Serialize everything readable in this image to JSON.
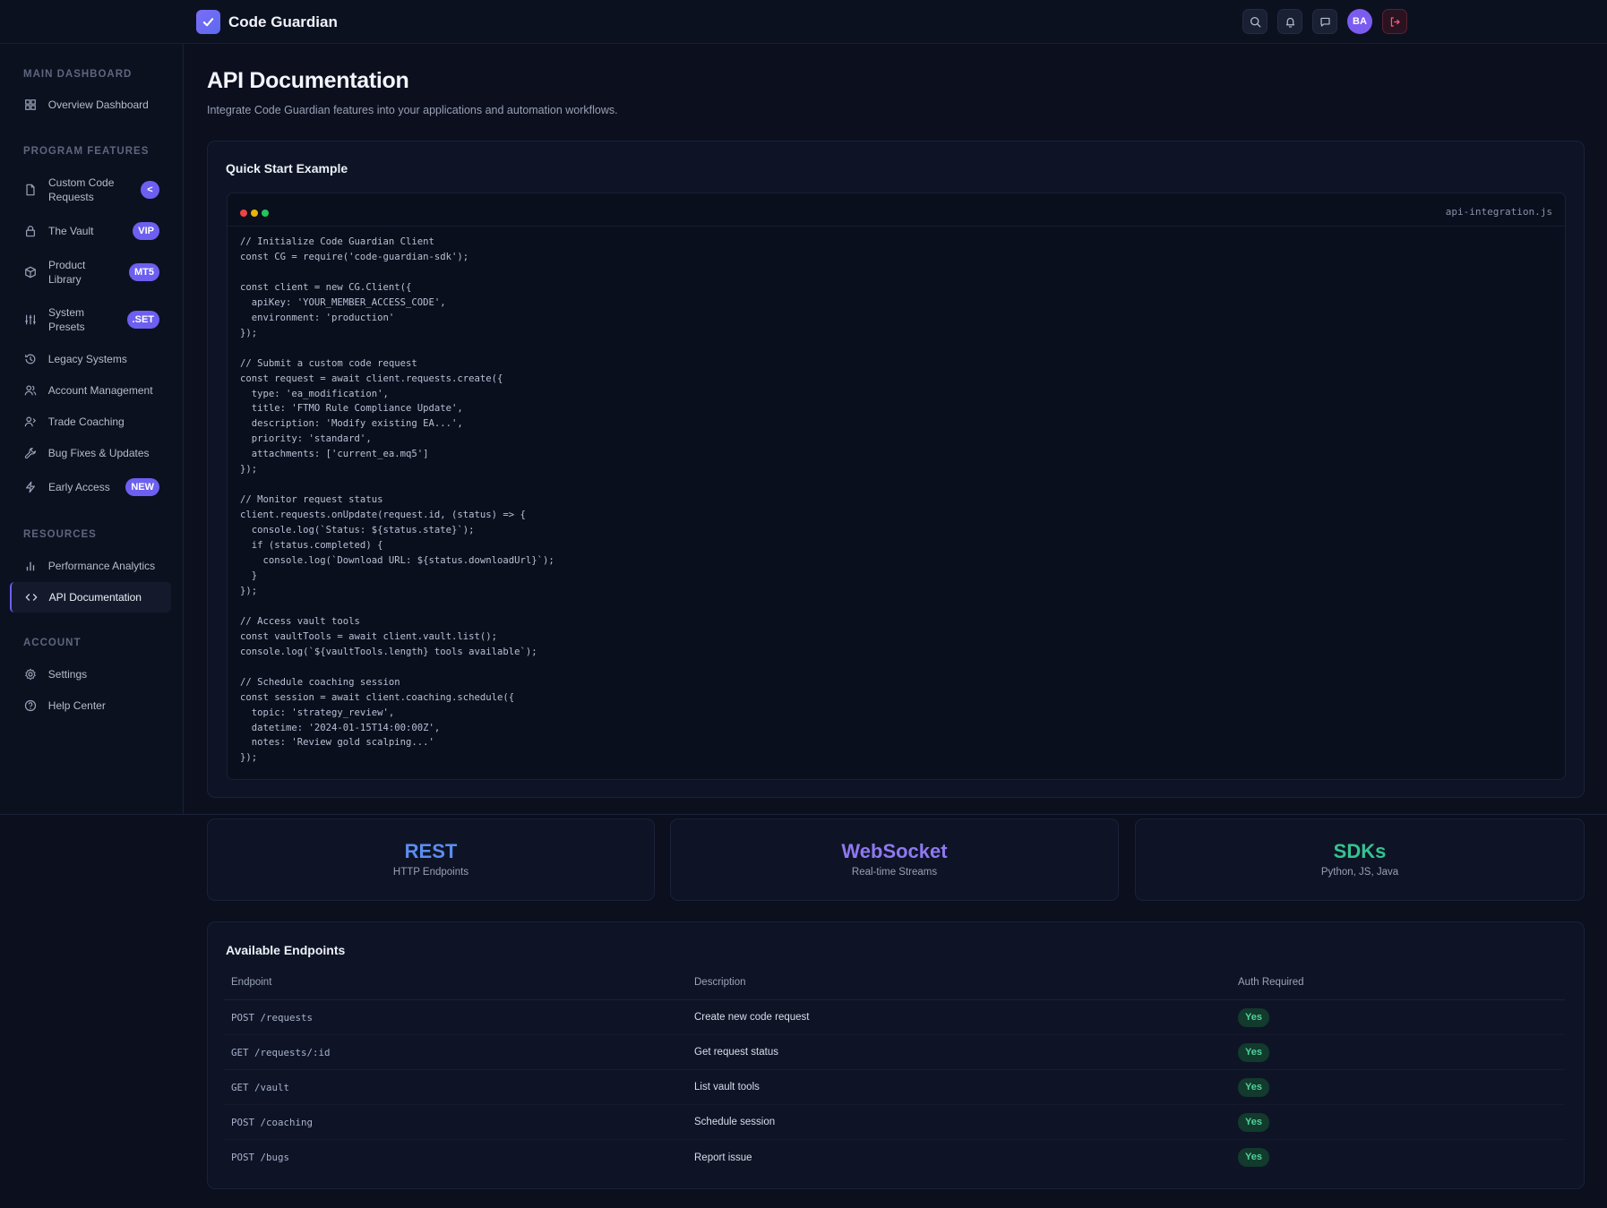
{
  "app": {
    "name": "Code Guardian",
    "user_initials": "BA"
  },
  "colors": {
    "accent": "#6d5ff0",
    "rest": "#5b8df0",
    "websocket": "#8f78f0",
    "sdks": "#34c38f",
    "success": "#4fd39a"
  },
  "topbar": {
    "icons": [
      "search-icon",
      "bell-icon",
      "message-icon",
      "logout-icon"
    ]
  },
  "sidebar": {
    "sections": {
      "main": "MAIN DASHBOARD",
      "features": "PROGRAM FEATURES",
      "resources": "RESOURCES",
      "account": "ACCOUNT"
    },
    "items": [
      {
        "label": "Overview Dashboard",
        "icon": "grid-icon"
      },
      {
        "label": "Custom Code Requests",
        "icon": "file-icon",
        "badge": "<"
      },
      {
        "label": "The Vault",
        "icon": "lock-icon",
        "badge": "VIP"
      },
      {
        "label": "Product Library",
        "icon": "box-icon",
        "badge": "MT5"
      },
      {
        "label": "System Presets",
        "icon": "sliders-icon",
        "badge": ".SET"
      },
      {
        "label": "Legacy Systems",
        "icon": "history-icon"
      },
      {
        "label": "Account Management",
        "icon": "users-icon"
      },
      {
        "label": "Trade Coaching",
        "icon": "coaching-icon"
      },
      {
        "label": "Bug Fixes & Updates",
        "icon": "wrench-icon"
      },
      {
        "label": "Early Access",
        "icon": "bolt-icon",
        "badge": "NEW"
      },
      {
        "label": "Performance Analytics",
        "icon": "bar-chart-icon"
      },
      {
        "label": "API Documentation",
        "icon": "code-icon",
        "active": true
      },
      {
        "label": "Settings",
        "icon": "gear-icon"
      },
      {
        "label": "Help Center",
        "icon": "help-icon"
      }
    ]
  },
  "main": {
    "title": "API Documentation",
    "subtitle": "Integrate Code Guardian features into your applications and automation workflows.",
    "quick_start": {
      "title": "Quick Start Example",
      "filename": "api-integration.js",
      "code": "// Initialize Code Guardian Client\nconst CG = require('code-guardian-sdk');\n\nconst client = new CG.Client({\n  apiKey: 'YOUR_MEMBER_ACCESS_CODE',\n  environment: 'production'\n});\n\n// Submit a custom code request\nconst request = await client.requests.create({\n  type: 'ea_modification',\n  title: 'FTMO Rule Compliance Update',\n  description: 'Modify existing EA...',\n  priority: 'standard',\n  attachments: ['current_ea.mq5']\n});\n\n// Monitor request status\nclient.requests.onUpdate(request.id, (status) => {\n  console.log(`Status: ${status.state}`);\n  if (status.completed) {\n    console.log(`Download URL: ${status.downloadUrl}`);\n  }\n});\n\n// Access vault tools\nconst vaultTools = await client.vault.list();\nconsole.log(`${vaultTools.length} tools available`);\n\n// Schedule coaching session\nconst session = await client.coaching.schedule({\n  topic: 'strategy_review',\n  datetime: '2024-01-15T14:00:00Z',\n  notes: 'Review gold scalping...'\n});"
    },
    "protocols": [
      {
        "title": "REST",
        "subtitle": "HTTP Endpoints"
      },
      {
        "title": "WebSocket",
        "subtitle": "Real-time Streams"
      },
      {
        "title": "SDKs",
        "subtitle": "Python, JS, Java"
      }
    ],
    "endpoints": {
      "title": "Available Endpoints",
      "columns": [
        "Endpoint",
        "Description",
        "Auth Required"
      ],
      "rows": [
        {
          "endpoint": "POST /requests",
          "description": "Create new code request",
          "auth": "Yes"
        },
        {
          "endpoint": "GET /requests/:id",
          "description": "Get request status",
          "auth": "Yes"
        },
        {
          "endpoint": "GET /vault",
          "description": "List vault tools",
          "auth": "Yes"
        },
        {
          "endpoint": "POST /coaching",
          "description": "Schedule session",
          "auth": "Yes"
        },
        {
          "endpoint": "POST /bugs",
          "description": "Report issue",
          "auth": "Yes"
        }
      ]
    }
  }
}
